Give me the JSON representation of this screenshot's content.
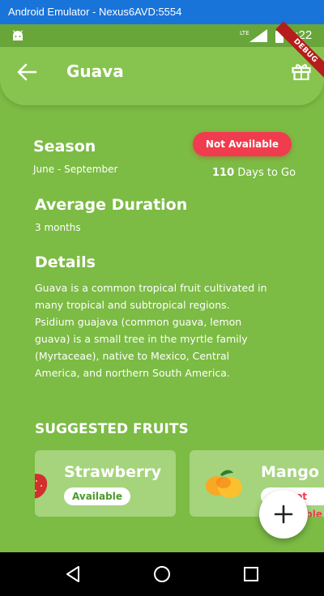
{
  "window": {
    "title": "Android Emulator - Nexus6AVD:5554"
  },
  "status_bar": {
    "time": "4:22",
    "network": "LTE"
  },
  "app_bar": {
    "title": "Guava",
    "debug_ribbon": "DEBUG"
  },
  "season": {
    "heading": "Season",
    "range": "June - September",
    "availability": "Not Available",
    "days_count": "110",
    "days_suffix": " Days to Go"
  },
  "duration": {
    "heading": "Average Duration",
    "value": "3 months"
  },
  "details": {
    "heading": "Details",
    "text": "Guava is a common tropical fruit cultivated in many tropical and subtropical regions. Psidium guajava (common guava, lemon guava) is a small tree in the myrtle family (Myrtaceae), native to Mexico, Central America, and northern South America."
  },
  "suggested": {
    "heading": "SUGGESTED FRUITS",
    "items": [
      {
        "name": "Strawberry",
        "status": "Available"
      },
      {
        "name": "Mango",
        "status": "Not Available"
      }
    ]
  },
  "colors": {
    "background": "#7cbb44",
    "app_bar": "#87c44f",
    "status_bar": "#69a63a",
    "not_available": "#f03c4e",
    "available_text": "#4c9a2a",
    "card": "#a5d47c"
  }
}
